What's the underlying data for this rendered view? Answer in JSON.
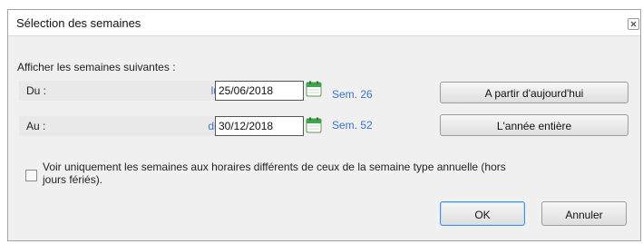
{
  "dialog": {
    "title": "Sélection des semaines",
    "section_label": "Afficher les semaines suivantes :",
    "from": {
      "label": "Du :",
      "day": "lun.",
      "date": "25/06/2018",
      "week": "Sem. 26"
    },
    "to": {
      "label": "Au :",
      "day": "dim.",
      "date": "30/12/2018",
      "week": "Sem. 52"
    },
    "buttons": {
      "from_today": "A partir d'aujourd'hui",
      "whole_year": "L'année entière",
      "ok": "OK",
      "cancel": "Annuler"
    },
    "checkbox": {
      "label": "Voir uniquement les semaines aux horaires différents de ceux de la semaine type annuelle (hors jours fériés).",
      "checked": false
    },
    "icons": {
      "close": "close-icon",
      "calendar": "calendar-icon"
    },
    "colors": {
      "accent": "#3b73c9",
      "calendar_green": "#3aa84a"
    }
  }
}
